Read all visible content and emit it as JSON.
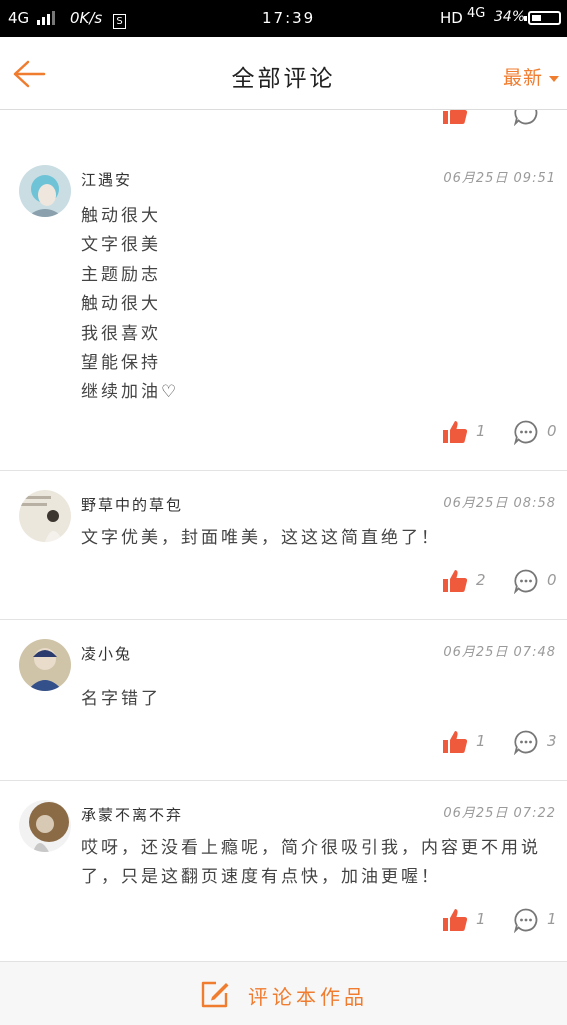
{
  "status_bar": {
    "network": "4G",
    "speed": "0K/s",
    "s_badge": "S",
    "time": "17:39",
    "hd": "HD",
    "network2": "4G",
    "battery": "34%",
    "battery_level": 0.34
  },
  "nav": {
    "title": "全部评论",
    "sort_label": "最新"
  },
  "comments": [
    {
      "name": "江遇安",
      "time": "06月25日  09:51",
      "text": "触动很大\n文字很美\n主题励志\n触动很大\n我很喜欢\n望能保持\n继续加油♡",
      "likes": "1",
      "replies": "0"
    },
    {
      "name": "野草中的草包",
      "time": "06月25日  08:58",
      "text": "文字优美，封面唯美，这这这简直绝了！",
      "likes": "2",
      "replies": "0"
    },
    {
      "name": "凌小兔",
      "time": "06月25日  07:48",
      "text": "名字错了",
      "likes": "1",
      "replies": "3"
    },
    {
      "name": "承蒙不离不弃",
      "time": "06月25日  07:22",
      "text": "哎呀，还没看上瘾呢，简介很吸引我，内容更不用说了，只是这翻页速度有点快，加油更喔！",
      "likes": "1",
      "replies": "1"
    }
  ],
  "footer": {
    "compose_label": "评论本作品"
  },
  "colors": {
    "accent": "#f07d2f",
    "like": "#f05a3c"
  }
}
